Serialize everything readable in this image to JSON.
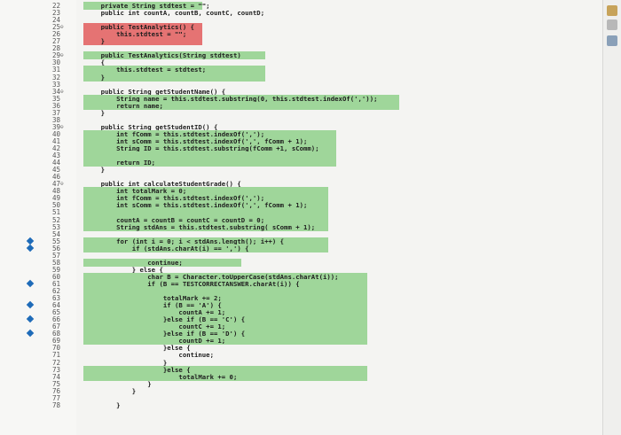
{
  "editor": {
    "lines": [
      {
        "n": "22",
        "code": "    private String stdtest = \"\";",
        "hl": "green",
        "hl_start": 0,
        "hl_len": 30,
        "fold": "",
        "bp": false
      },
      {
        "n": "23",
        "code": "    public int countA, countB, countC, countD;",
        "hl": "",
        "hl_start": 0,
        "hl_len": 0,
        "fold": "",
        "bp": false
      },
      {
        "n": "24",
        "code": "",
        "hl": "",
        "hl_start": 0,
        "hl_len": 0,
        "fold": "",
        "bp": false
      },
      {
        "n": "25",
        "code": "    public TestAnalytics() {",
        "hl": "red",
        "hl_start": 0,
        "hl_len": 30,
        "fold": "⊖",
        "bp": false
      },
      {
        "n": "26",
        "code": "        this.stdtest = \"\";",
        "hl": "red",
        "hl_start": 0,
        "hl_len": 30,
        "fold": "",
        "bp": false
      },
      {
        "n": "27",
        "code": "    }",
        "hl": "red",
        "hl_start": 0,
        "hl_len": 30,
        "fold": "",
        "bp": false
      },
      {
        "n": "28",
        "code": "",
        "hl": "",
        "hl_start": 0,
        "hl_len": 0,
        "fold": "",
        "bp": false
      },
      {
        "n": "29",
        "code": "    public TestAnalytics(String stdtest)",
        "hl": "green",
        "hl_start": 0,
        "hl_len": 46,
        "fold": "⊖",
        "bp": false
      },
      {
        "n": "30",
        "code": "    {",
        "hl": "",
        "hl_start": 0,
        "hl_len": 0,
        "fold": "",
        "bp": false
      },
      {
        "n": "31",
        "code": "        this.stdtest = stdtest;",
        "hl": "green",
        "hl_start": 0,
        "hl_len": 46,
        "fold": "",
        "bp": false
      },
      {
        "n": "32",
        "code": "    }",
        "hl": "green",
        "hl_start": 0,
        "hl_len": 46,
        "fold": "",
        "bp": false
      },
      {
        "n": "33",
        "code": "",
        "hl": "",
        "hl_start": 0,
        "hl_len": 0,
        "fold": "",
        "bp": false
      },
      {
        "n": "34",
        "code": "    public String getStudentName() {",
        "hl": "",
        "hl_start": 0,
        "hl_len": 0,
        "fold": "⊖",
        "bp": false
      },
      {
        "n": "35",
        "code": "        String name = this.stdtest.substring(0, this.stdtest.indexOf(','));",
        "hl": "green",
        "hl_start": 0,
        "hl_len": 80,
        "fold": "",
        "bp": false
      },
      {
        "n": "36",
        "code": "        return name;",
        "hl": "green",
        "hl_start": 0,
        "hl_len": 80,
        "fold": "",
        "bp": false
      },
      {
        "n": "37",
        "code": "    }",
        "hl": "",
        "hl_start": 0,
        "hl_len": 0,
        "fold": "",
        "bp": false
      },
      {
        "n": "38",
        "code": "",
        "hl": "",
        "hl_start": 0,
        "hl_len": 0,
        "fold": "",
        "bp": false
      },
      {
        "n": "39",
        "code": "    public String getStudentID() {",
        "hl": "",
        "hl_start": 0,
        "hl_len": 0,
        "fold": "⊖",
        "bp": false
      },
      {
        "n": "40",
        "code": "        int fComm = this.stdtest.indexOf(',');",
        "hl": "green",
        "hl_start": 0,
        "hl_len": 64,
        "fold": "",
        "bp": false
      },
      {
        "n": "41",
        "code": "        int sComm = this.stdtest.indexOf(',', fComm + 1);",
        "hl": "green",
        "hl_start": 0,
        "hl_len": 64,
        "fold": "",
        "bp": false
      },
      {
        "n": "42",
        "code": "        String ID = this.stdtest.substring(fComm +1, sComm);",
        "hl": "green",
        "hl_start": 0,
        "hl_len": 64,
        "fold": "",
        "bp": false
      },
      {
        "n": "43",
        "code": "",
        "hl": "green",
        "hl_start": 0,
        "hl_len": 64,
        "fold": "",
        "bp": false
      },
      {
        "n": "44",
        "code": "        return ID;",
        "hl": "green",
        "hl_start": 0,
        "hl_len": 64,
        "fold": "",
        "bp": false
      },
      {
        "n": "45",
        "code": "    }",
        "hl": "",
        "hl_start": 0,
        "hl_len": 0,
        "fold": "",
        "bp": false
      },
      {
        "n": "46",
        "code": "",
        "hl": "",
        "hl_start": 0,
        "hl_len": 0,
        "fold": "",
        "bp": false
      },
      {
        "n": "47",
        "code": "    public int calculateStudentGrade() {",
        "hl": "",
        "hl_start": 0,
        "hl_len": 0,
        "fold": "⊖",
        "bp": false
      },
      {
        "n": "48",
        "code": "        int totalMark = 0;",
        "hl": "green",
        "hl_start": 0,
        "hl_len": 62,
        "fold": "",
        "bp": false
      },
      {
        "n": "49",
        "code": "        int fComm = this.stdtest.indexOf(',');",
        "hl": "green",
        "hl_start": 0,
        "hl_len": 62,
        "fold": "",
        "bp": false
      },
      {
        "n": "50",
        "code": "        int sComm = this.stdtest.indexOf(',', fComm + 1);",
        "hl": "green",
        "hl_start": 0,
        "hl_len": 62,
        "fold": "",
        "bp": false
      },
      {
        "n": "51",
        "code": "",
        "hl": "green",
        "hl_start": 0,
        "hl_len": 62,
        "fold": "",
        "bp": false
      },
      {
        "n": "52",
        "code": "        countA = countB = countC = countD = 0;",
        "hl": "green",
        "hl_start": 0,
        "hl_len": 62,
        "fold": "",
        "bp": false
      },
      {
        "n": "53",
        "code": "        String stdAns = this.stdtest.substring( sComm + 1);",
        "hl": "green",
        "hl_start": 0,
        "hl_len": 62,
        "fold": "",
        "bp": false
      },
      {
        "n": "54",
        "code": "",
        "hl": "",
        "hl_start": 0,
        "hl_len": 0,
        "fold": "",
        "bp": false
      },
      {
        "n": "55",
        "code": "        for (int i = 0; i < stdAns.length(); i++) {",
        "hl": "green",
        "hl_start": 0,
        "hl_len": 62,
        "fold": "",
        "bp": true
      },
      {
        "n": "56",
        "code": "            if (stdAns.charAt(i) == ',') {",
        "hl": "green",
        "hl_start": 0,
        "hl_len": 62,
        "fold": "",
        "bp": true
      },
      {
        "n": "57",
        "code": "",
        "hl": "",
        "hl_start": 0,
        "hl_len": 0,
        "fold": "",
        "bp": false
      },
      {
        "n": "58",
        "code": "                continue;",
        "hl": "green",
        "hl_start": 0,
        "hl_len": 40,
        "fold": "",
        "bp": false
      },
      {
        "n": "59",
        "code": "            } else {",
        "hl": "",
        "hl_start": 0,
        "hl_len": 0,
        "fold": "",
        "bp": false
      },
      {
        "n": "60",
        "code": "                char B = Character.toUpperCase(stdAns.charAt(i));",
        "hl": "green",
        "hl_start": 0,
        "hl_len": 72,
        "fold": "",
        "bp": false
      },
      {
        "n": "61",
        "code": "                if (B == TESTCORRECTANSWER.charAt(i)) {",
        "hl": "green",
        "hl_start": 0,
        "hl_len": 72,
        "fold": "",
        "bp": true
      },
      {
        "n": "62",
        "code": "",
        "hl": "green",
        "hl_start": 0,
        "hl_len": 72,
        "fold": "",
        "bp": false
      },
      {
        "n": "63",
        "code": "                    totalMark += 2;",
        "hl": "green",
        "hl_start": 0,
        "hl_len": 72,
        "fold": "",
        "bp": false
      },
      {
        "n": "64",
        "code": "                    if (B == 'A') {",
        "hl": "green",
        "hl_start": 0,
        "hl_len": 72,
        "fold": "",
        "bp": true
      },
      {
        "n": "65",
        "code": "                        countA += 1;",
        "hl": "green",
        "hl_start": 0,
        "hl_len": 72,
        "fold": "",
        "bp": false
      },
      {
        "n": "66",
        "code": "                    }else if (B == 'C') {",
        "hl": "green",
        "hl_start": 0,
        "hl_len": 72,
        "fold": "",
        "bp": true
      },
      {
        "n": "67",
        "code": "                        countC += 1;",
        "hl": "green",
        "hl_start": 0,
        "hl_len": 72,
        "fold": "",
        "bp": false
      },
      {
        "n": "68",
        "code": "                    }else if (B == 'D') {",
        "hl": "green",
        "hl_start": 0,
        "hl_len": 72,
        "fold": "",
        "bp": true
      },
      {
        "n": "69",
        "code": "                        countD += 1;",
        "hl": "green",
        "hl_start": 0,
        "hl_len": 72,
        "fold": "",
        "bp": false
      },
      {
        "n": "70",
        "code": "                    }else {",
        "hl": "",
        "hl_start": 0,
        "hl_len": 0,
        "fold": "",
        "bp": false
      },
      {
        "n": "71",
        "code": "                        continue;",
        "hl": "",
        "hl_start": 0,
        "hl_len": 0,
        "fold": "",
        "bp": false
      },
      {
        "n": "72",
        "code": "                    }",
        "hl": "",
        "hl_start": 0,
        "hl_len": 0,
        "fold": "",
        "bp": false
      },
      {
        "n": "73",
        "code": "                    }else {",
        "hl": "green",
        "hl_start": 0,
        "hl_len": 72,
        "fold": "",
        "bp": false
      },
      {
        "n": "74",
        "code": "                        totalMark += 0;",
        "hl": "green",
        "hl_start": 0,
        "hl_len": 72,
        "fold": "",
        "bp": false
      },
      {
        "n": "75",
        "code": "                }",
        "hl": "",
        "hl_start": 0,
        "hl_len": 0,
        "fold": "",
        "bp": false
      },
      {
        "n": "76",
        "code": "            }",
        "hl": "",
        "hl_start": 0,
        "hl_len": 0,
        "fold": "",
        "bp": false
      },
      {
        "n": "77",
        "code": "",
        "hl": "",
        "hl_start": 0,
        "hl_len": 0,
        "fold": "",
        "bp": false
      },
      {
        "n": "78",
        "code": "        }",
        "hl": "",
        "hl_start": 0,
        "hl_len": 0,
        "fold": "",
        "bp": false
      }
    ]
  },
  "colors": {
    "covered": "#9fd69a",
    "not_covered": "#e57373",
    "breakpoint": "#1e6bb8"
  },
  "side_icons": [
    "outline-icon",
    "task-icon",
    "console-icon"
  ]
}
